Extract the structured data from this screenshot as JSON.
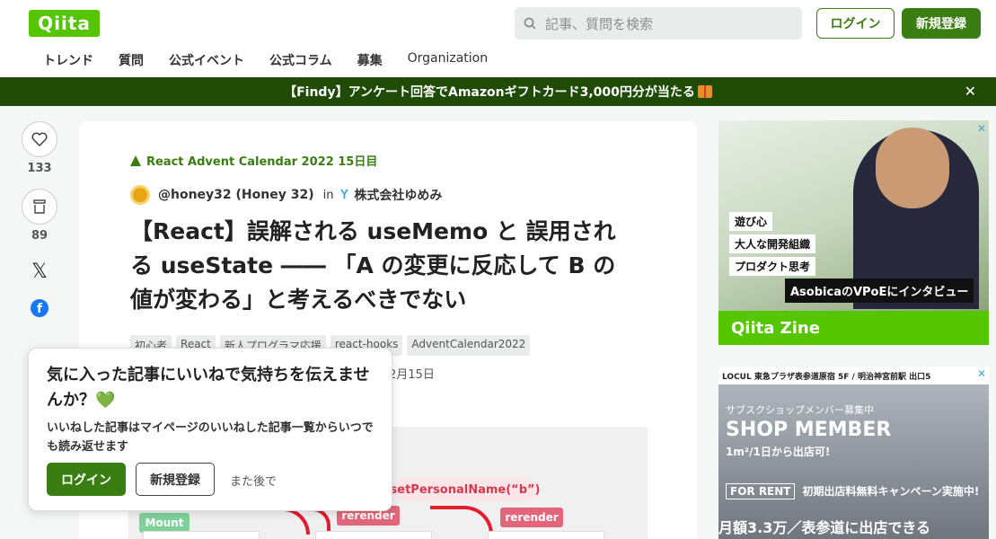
{
  "header": {
    "logo": "Qiita",
    "search_placeholder": "記事、質問を検索",
    "login": "ログイン",
    "signup": "新規登録",
    "nav": [
      "トレンド",
      "質問",
      "公式イベント",
      "公式コラム",
      "募集",
      "Organization"
    ]
  },
  "banner": {
    "text": "【Findy】アンケート回答でAmazonギフトカード3,000円分が当たる",
    "close": "✕"
  },
  "sidebar": {
    "likes": "133",
    "stocks": "89"
  },
  "article": {
    "calendar": "React Advent Calendar 2022 15日目",
    "author": "@honey32 (Honey 32)",
    "in": "in",
    "org": "株式会社ゆめみ",
    "title": "【React】誤解される useMemo と 誤用される useState ―― 「A の変更に反応して B の値が変わる」と考えるべきでない",
    "tags": [
      "初心者",
      "React",
      "新人プログラマ応援",
      "react-hooks",
      "AdventCalendar2022"
    ],
    "date": "2月15日",
    "diagram": {
      "bubble": "setPersonalName(“b”)",
      "rerender1": "rerender",
      "rerender2": "rerender",
      "mount": "Mount"
    }
  },
  "popup": {
    "title": "気に入った記事にいいねで気持ちを伝えませんか？💚",
    "body": "いいねした記事はマイページのいいねした記事一覧からいつでも読み返せます",
    "login": "ログイン",
    "signup": "新規登録",
    "later": "また後で"
  },
  "ad1": {
    "l1": "遊び心",
    "l2": "大人な開発組織",
    "l3": "プロダクト思考",
    "caption": "AsobicaのVPoEにインタビュー",
    "zine": "Qiita Zine"
  },
  "ad2": {
    "top": "LOCUL  東急プラザ表参道原宿 5F / 明治神宮前駅 出口5",
    "t1": "サブスクショップメンバー募集中",
    "t2": "SHOP MEMBER",
    "t3": "1m²/1日から出店可!",
    "t4a": "FOR RENT",
    "t4b": "初期出店料無料キャンペーン実施中!",
    "t5": "月額3.3万／表参道に出店できる"
  }
}
